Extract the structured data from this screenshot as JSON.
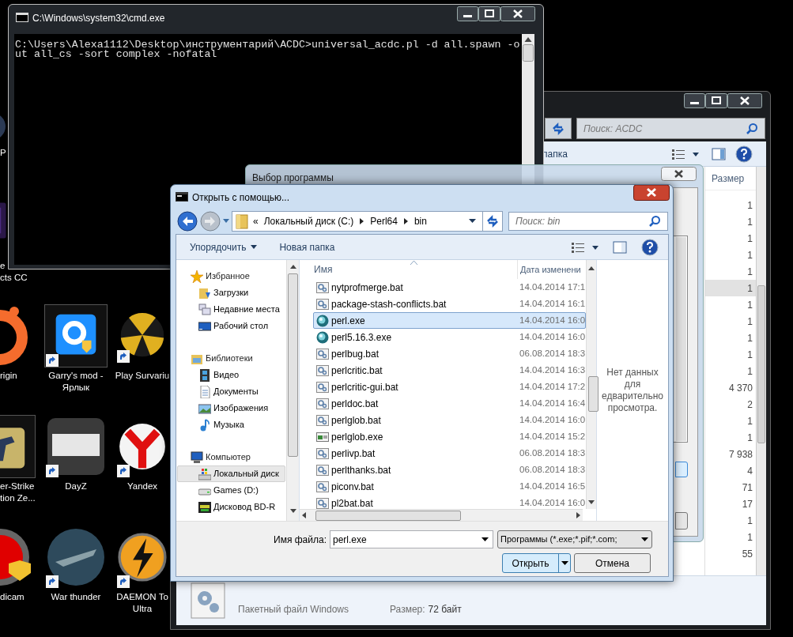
{
  "desktop": {
    "icons": [
      {
        "label_lines": [
          "P"
        ],
        "kind": "lens",
        "shortcut": false,
        "selected": false
      },
      {
        "label_lines": [
          "e",
          "cts CC"
        ],
        "kind": "purple",
        "shortcut": false,
        "selected": false
      },
      {
        "label_lines": [
          "rigin"
        ],
        "kind": "ring",
        "shortcut": false,
        "selected": false
      },
      {
        "label_lines": [
          "Garry's mod -",
          "Ярлык"
        ],
        "kind": "tile",
        "shortcut": true,
        "selected": true
      },
      {
        "label_lines": [
          "Play Survariu"
        ],
        "kind": "burst",
        "shortcut": true,
        "selected": false
      },
      {
        "label_lines": [
          "er-Strike",
          "tion Ze..."
        ],
        "kind": "badge",
        "shortcut": false,
        "selected": true
      },
      {
        "label_lines": [
          "DayZ"
        ],
        "kind": "grunge",
        "shortcut": true,
        "selected": false
      },
      {
        "label_lines": [
          "Yandex"
        ],
        "kind": "ybrowser",
        "shortcut": true,
        "selected": false
      },
      {
        "label_lines": [
          "dicam"
        ],
        "kind": "record",
        "shortcut": false,
        "selected": false
      },
      {
        "label_lines": [
          "War thunder"
        ],
        "kind": "globe",
        "shortcut": true,
        "selected": false
      },
      {
        "label_lines": [
          "DAEMON To",
          "Ultra"
        ],
        "kind": "bolt",
        "shortcut": true,
        "selected": false
      }
    ]
  },
  "explorer": {
    "search_placeholder": "Поиск: ACDC",
    "toolbar_text": "папка",
    "size_column": "Размер",
    "rows": [
      {
        "size": "1",
        "selected": false
      },
      {
        "size": "1",
        "selected": false
      },
      {
        "size": "1",
        "selected": false
      },
      {
        "size": "1",
        "selected": false
      },
      {
        "size": "1",
        "selected": false
      },
      {
        "size": "1",
        "selected": true
      },
      {
        "size": "1",
        "selected": false
      },
      {
        "size": "1",
        "selected": false
      },
      {
        "size": "1",
        "selected": false
      },
      {
        "size": "1",
        "selected": false
      },
      {
        "size": "1",
        "selected": false
      },
      {
        "size": "4 370",
        "selected": false
      },
      {
        "size": "2",
        "selected": false
      },
      {
        "size": "1",
        "selected": false
      },
      {
        "size": "1",
        "selected": false
      },
      {
        "size": "7 938",
        "selected": false
      },
      {
        "size": "4",
        "selected": false
      },
      {
        "size": "71",
        "selected": false
      },
      {
        "size": "17",
        "selected": false
      },
      {
        "size": "1",
        "selected": false
      },
      {
        "size": "1",
        "selected": false
      },
      {
        "size": "55",
        "selected": false
      }
    ],
    "details": {
      "type": "Пакетный файл Windows",
      "size_label": "Размер:",
      "size": "72 байт"
    }
  },
  "cmd": {
    "title": "C:\\Windows\\system32\\cmd.exe",
    "lines": [
      "C:\\Users\\Alexa1112\\Desktop\\инструментарий\\ACDC>universal_acdc.pl -d all.spawn -o",
      "ut all_cs -sort complex -nofatal"
    ]
  },
  "chooser": {
    "title": "Выбор программы"
  },
  "open_dialog": {
    "title": "Открыть с помощью...",
    "breadcrumb": [
      "«",
      "Локальный диск (C:)",
      "Perl64",
      "bin"
    ],
    "search_placeholder": "Поиск: bin",
    "toolbar": [
      "Упорядочить",
      "Новая папка"
    ],
    "nav": [
      {
        "label": "Избранное",
        "kind": "star",
        "selected": false,
        "children": [
          {
            "label": "Загрузки",
            "kind": "downloads",
            "selected": false
          },
          {
            "label": "Недавние места",
            "kind": "recent",
            "selected": false
          },
          {
            "label": "Рабочий стол",
            "kind": "desktop",
            "selected": false
          }
        ]
      },
      {
        "label": "Библиотеки",
        "kind": "library",
        "selected": false,
        "children": [
          {
            "label": "Видео",
            "kind": "video",
            "selected": false
          },
          {
            "label": "Документы",
            "kind": "docs",
            "selected": false
          },
          {
            "label": "Изображения",
            "kind": "images",
            "selected": false
          },
          {
            "label": "Музыка",
            "kind": "music",
            "selected": false
          }
        ]
      },
      {
        "label": "Компьютер",
        "kind": "computer",
        "selected": false,
        "children": [
          {
            "label": "Локальный диск",
            "kind": "osdrive",
            "selected": true
          },
          {
            "label": "Games (D:)",
            "kind": "drive",
            "selected": false
          },
          {
            "label": "Дисковод BD-R",
            "kind": "disc",
            "selected": false
          }
        ]
      }
    ],
    "columns": [
      "Имя",
      "Дата изменени"
    ],
    "files": [
      {
        "name": "nytprofmerge.bat",
        "date": "14.04.2014 17:1",
        "kind": "script",
        "selected": false
      },
      {
        "name": "package-stash-conflicts.bat",
        "date": "14.04.2014 16:1",
        "kind": "script",
        "selected": false
      },
      {
        "name": "perl.exe",
        "date": "14.04.2014 16:0",
        "kind": "perl",
        "selected": true
      },
      {
        "name": "perl5.16.3.exe",
        "date": "14.04.2014 16:0",
        "kind": "perl",
        "selected": false
      },
      {
        "name": "perlbug.bat",
        "date": "06.08.2014 18:3",
        "kind": "script",
        "selected": false
      },
      {
        "name": "perlcritic.bat",
        "date": "14.04.2014 16:3",
        "kind": "script",
        "selected": false
      },
      {
        "name": "perlcritic-gui.bat",
        "date": "14.04.2014 17:2",
        "kind": "script",
        "selected": false
      },
      {
        "name": "perldoc.bat",
        "date": "14.04.2014 16:4",
        "kind": "script",
        "selected": false
      },
      {
        "name": "perlglob.bat",
        "date": "14.04.2014 16:0",
        "kind": "script",
        "selected": false
      },
      {
        "name": "perlglob.exe",
        "date": "14.04.2014 15:2",
        "kind": "app",
        "selected": false
      },
      {
        "name": "perlivp.bat",
        "date": "06.08.2014 18:3",
        "kind": "script",
        "selected": false
      },
      {
        "name": "perlthanks.bat",
        "date": "06.08.2014 18:3",
        "kind": "script",
        "selected": false
      },
      {
        "name": "piconv.bat",
        "date": "14.04.2014 16:5",
        "kind": "script",
        "selected": false
      },
      {
        "name": "pl2bat.bat",
        "date": "14.04.2014 16:0",
        "kind": "script",
        "selected": false
      }
    ],
    "preview_lines": [
      "Нет данных",
      "для",
      "едварительно",
      "просмотра."
    ],
    "filename_label": "Имя файла:",
    "filename": "perl.exe",
    "filter": "Программы (*.exe;*.pif;*.com;",
    "buttons": [
      {
        "label": "Открыть",
        "default": true
      },
      {
        "label": "Отмена",
        "default": false
      }
    ]
  }
}
